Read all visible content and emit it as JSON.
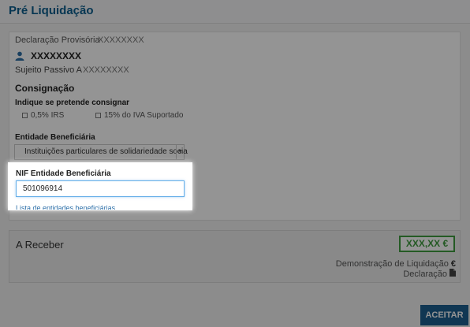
{
  "page": {
    "title": "Pré Liquidação"
  },
  "declaration": {
    "label": "Declaração Provisória",
    "value": "XXXXXXXX"
  },
  "taxpayer": {
    "name": "XXXXXXXX",
    "subject_label": "Sujeito Passivo A",
    "subject_value": "XXXXXXXX",
    "icon": "user-icon"
  },
  "consignment": {
    "title": "Consignação",
    "question": "Indique se pretende consignar",
    "options": [
      {
        "label": "0,5% IRS",
        "checked": false
      },
      {
        "label": "15% do IVA Suportado",
        "checked": false
      }
    ]
  },
  "beneficiary": {
    "label": "Entidade Beneficiária",
    "selected": "Instituições particulares de solidariedade socia",
    "nif_label": "NIF Entidade Beneficiária",
    "nif_value": "501096914",
    "list_link": "Lista de entidades beneficiárias"
  },
  "summary": {
    "receive_label": "A Receber",
    "amount": "XXX,XX €",
    "demo_label": "Demonstração de Liquidação",
    "demo_icon": "€",
    "declaration_label": "Declaração",
    "declaration_icon": "document-icon"
  },
  "actions": {
    "accept": "ACEITAR"
  },
  "colors": {
    "accent": "#0b5e8e",
    "button": "#1d5f8f",
    "success": "#3f9b3f",
    "link": "#2b6ea8"
  }
}
